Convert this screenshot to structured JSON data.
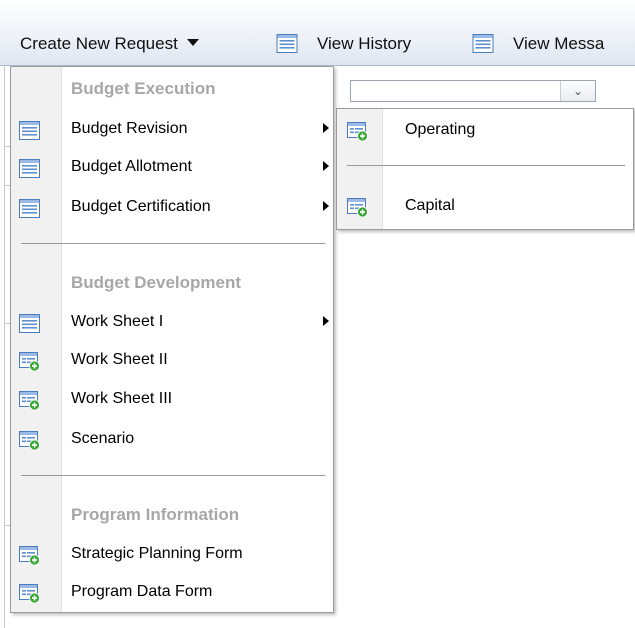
{
  "toolbar": {
    "create_label": "Create New Request",
    "history_label": "View History",
    "messages_label": "View Messa",
    "create_icon": "caret-down-icon",
    "history_icon": "list-icon",
    "messages_icon": "list-icon"
  },
  "main_menu": {
    "sections": [
      {
        "header": "Budget Execution",
        "items": [
          {
            "label": "Budget Revision",
            "icon": "list-icon",
            "has_submenu": true
          },
          {
            "label": "Budget Allotment",
            "icon": "list-icon",
            "has_submenu": true
          },
          {
            "label": "Budget Certification",
            "icon": "list-icon",
            "has_submenu": true
          }
        ]
      },
      {
        "header": "Budget Development",
        "items": [
          {
            "label": "Work Sheet I",
            "icon": "list-icon",
            "has_submenu": true
          },
          {
            "label": "Work Sheet II",
            "icon": "form-add-icon",
            "has_submenu": false
          },
          {
            "label": "Work Sheet III",
            "icon": "form-add-icon",
            "has_submenu": false
          },
          {
            "label": "Scenario",
            "icon": "form-add-icon",
            "has_submenu": false
          }
        ]
      },
      {
        "header": "Program Information",
        "items": [
          {
            "label": "Strategic Planning Form",
            "icon": "form-add-icon",
            "has_submenu": false
          },
          {
            "label": "Program Data Form",
            "icon": "form-add-icon",
            "has_submenu": false
          }
        ]
      }
    ]
  },
  "sub_menu": {
    "items": [
      {
        "label": "Operating",
        "icon": "form-add-icon"
      },
      {
        "label": "Capital",
        "icon": "form-add-icon"
      }
    ]
  },
  "colors": {
    "header_text": "#a7a7a7",
    "gutter": "#f1f1f1",
    "icon_blue": "#3f6fb0",
    "icon_green": "#3aa636"
  }
}
